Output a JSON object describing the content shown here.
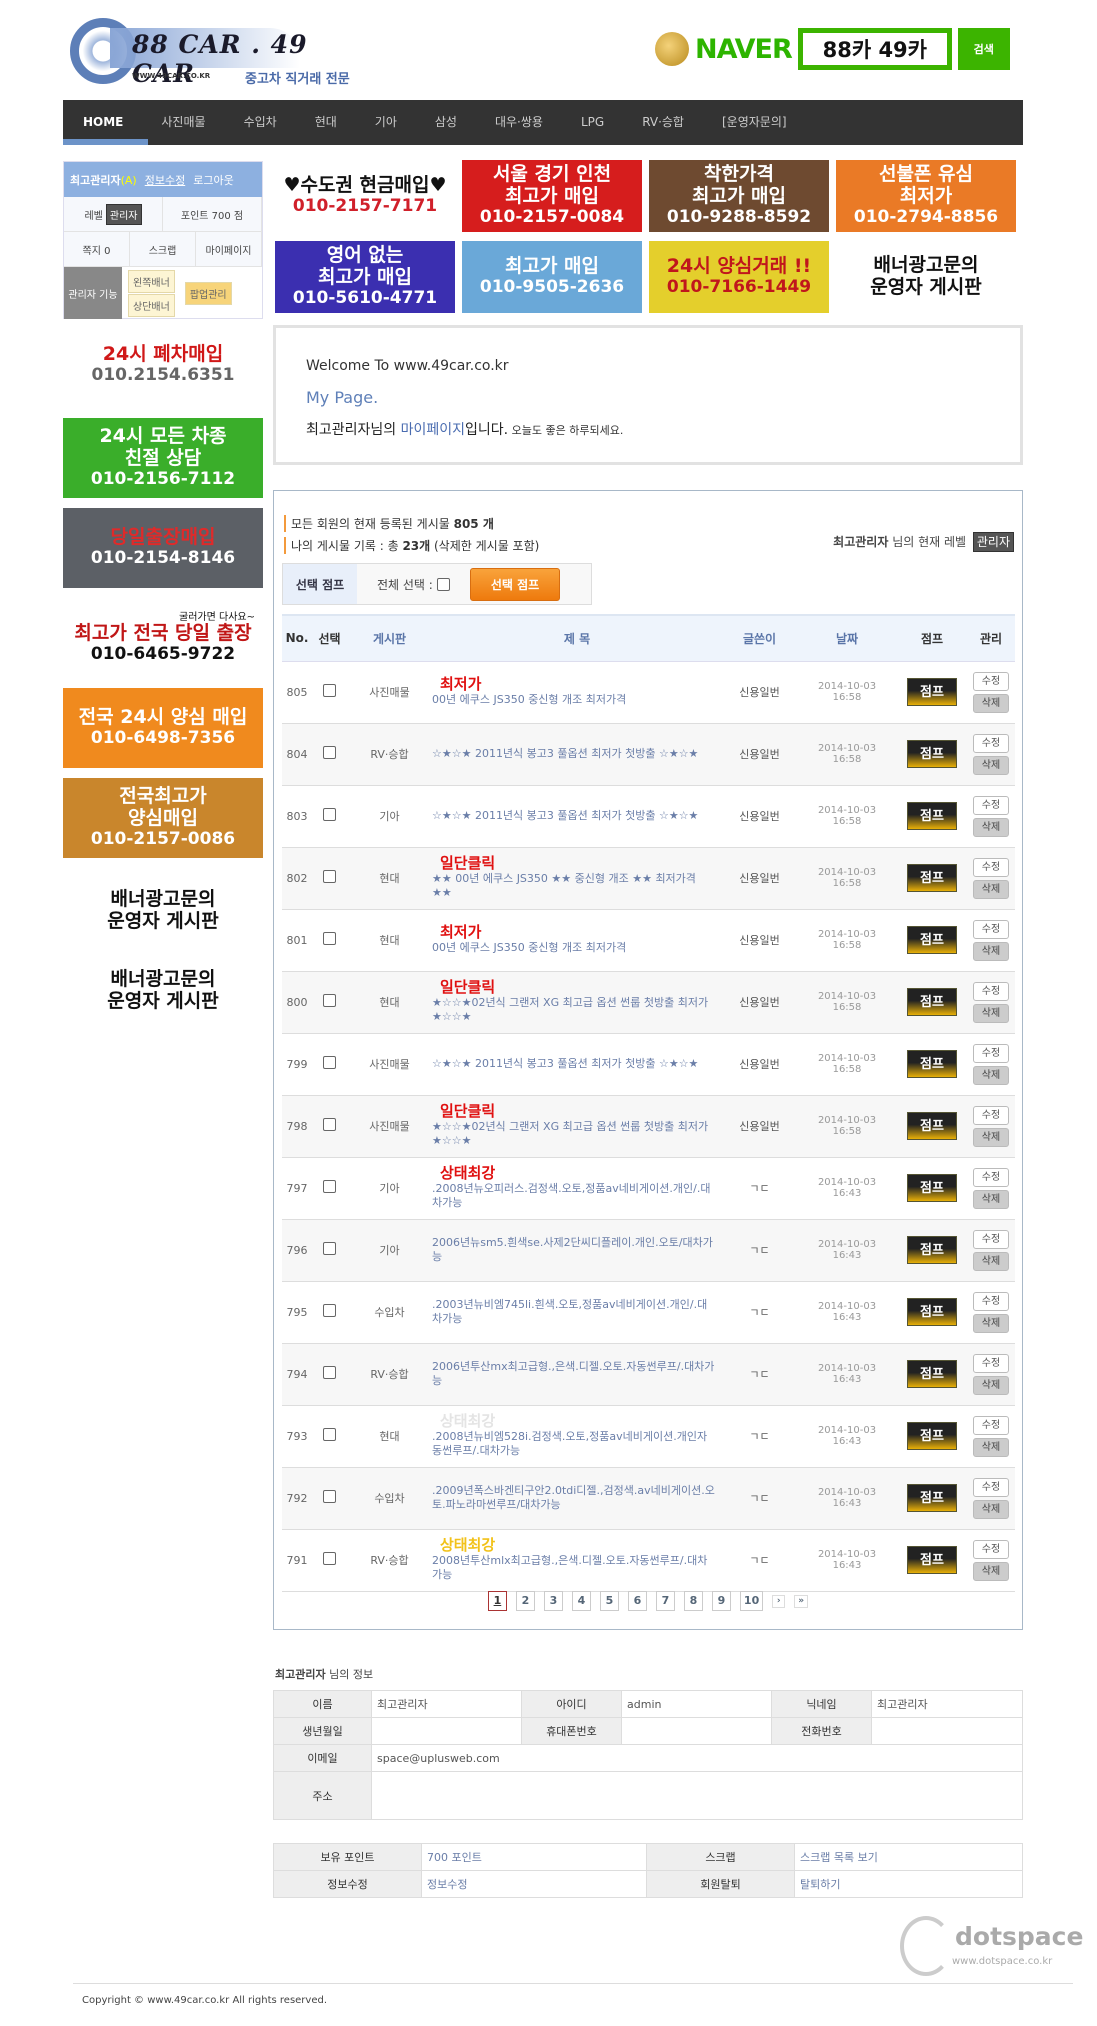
{
  "header": {
    "logo_title": "88 CAR . 49 CAR",
    "logo_url": "WWW.49CAR.CO.KR",
    "logo_sub": "중고차 직거래 전문",
    "naver_word": "NAVER",
    "naver_query": "88카 49카",
    "naver_search": "검색"
  },
  "nav": [
    "HOME",
    "사진매물",
    "수입차",
    "현대",
    "기아",
    "삼성",
    "대우·쌍용",
    "LPG",
    "RV·승합",
    "[운영자문의]"
  ],
  "login": {
    "user": "최고관리자",
    "grade": "(A)",
    "edit": "정보수정",
    "logout": "로그아웃",
    "level_label": "레벨",
    "level": "관리자",
    "points": "포인트 700 점",
    "memo": "쪽지 0",
    "scrap": "스크랩",
    "mypage": "마이페이지",
    "admin_label": "관리자 기능",
    "left_banner": "왼쪽배너",
    "top_banner": "상단배너",
    "popup": "팝업관리"
  },
  "top_banners": [
    {
      "t": "♥수도권 현금매입♥",
      "p": "010-2157-7171",
      "bg": "#ffffff",
      "fg": "#111",
      "pc": "#d0202a"
    },
    {
      "t": "서울 경기 인천\n최고가 매입",
      "p": "010-2157-0084",
      "bg": "#d61d1d",
      "fg": "#fff",
      "pc": "#fff"
    },
    {
      "t": "착한가격\n최고가 매입",
      "p": "010-9288-8592",
      "bg": "#6e4a30",
      "fg": "#fff",
      "pc": "#fff"
    },
    {
      "t": "선불폰 유심\n최저가",
      "p": "010-2794-8856",
      "bg": "#ea7a26",
      "fg": "#fff",
      "pc": "#fff"
    },
    {
      "t": "영어 없는\n최고가 매입",
      "p": "010-5610-4771",
      "bg": "#3b2fb0",
      "fg": "#fff",
      "pc": "#fff"
    },
    {
      "t": "최고가 매입",
      "p": "010-9505-2636",
      "bg": "#6aa8d8",
      "fg": "#fff",
      "pc": "#fff"
    },
    {
      "t": "24시 양심거래 !!",
      "p": "010-7166-1449",
      "bg": "#e4cf2c",
      "fg": "#c0161c",
      "pc": "#c0161c"
    },
    {
      "t": "배너광고문의\n운영자 게시판",
      "p": "",
      "bg": "#ffffff",
      "fg": "#111",
      "pc": "#111"
    }
  ],
  "left_banners": [
    {
      "t": "24시 폐차매입",
      "p": "010.2154.6351",
      "bg": "#ffffff",
      "fg": "#d01818",
      "pc": "#666"
    },
    {
      "t": "24시 모든 차종\n친절 상담",
      "p": "010-2156-7112",
      "bg": "#3aae2a",
      "fg": "#fff",
      "pc": "#fff"
    },
    {
      "t": "당일출장매입",
      "p": "010-2154-8146",
      "bg": "#5c6066",
      "fg": "#e02a2a",
      "pc": "#fff"
    },
    {
      "t": "최고가 전국 당일 출장",
      "sub": "굴러가면 다사요~",
      "p": "010-6465-9722",
      "bg": "#ffffff",
      "fg": "#c01616",
      "pc": "#111"
    },
    {
      "t": "전국 24시 양심 매입",
      "p": "010-6498-7356",
      "bg": "#f08a1e",
      "fg": "#fff",
      "pc": "#fff"
    },
    {
      "t": "전국최고가\n양심매입",
      "p": "010-2157-0086",
      "bg": "#c9862c",
      "fg": "#fff",
      "pc": "#fff"
    },
    {
      "t": "배너광고문의\n운영자 게시판",
      "p": "",
      "bg": "#ffffff",
      "fg": "#111",
      "pc": "#111"
    },
    {
      "t": "배너광고문의\n운영자 게시판",
      "p": "",
      "bg": "#ffffff",
      "fg": "#111",
      "pc": "#111"
    }
  ],
  "welcome": {
    "line1": "Welcome To www.49car.co.kr",
    "line2": "My Page.",
    "name": "최고관리자님의 ",
    "hl": "마이페이지",
    "end": "입니다.",
    "greet": " 오늘도 좋은 하루되세요."
  },
  "board": {
    "stat1_pre": "모든 회원의 현재 등록된 게시물 ",
    "stat1_count": "805 개",
    "stat2_pre": "나의 게시물 기록 : 총 ",
    "stat2_count": "23개",
    "stat2_post": " (삭제한 게시물 포함)",
    "level_user": "최고관리자",
    "level_text": " 님의 현재 레벨 ",
    "level_badge": "관리자",
    "jump_label": "선택 점프",
    "select_all": "전체 선택 :",
    "jump_button": "선택 점프",
    "columns": [
      "No.",
      "선택",
      "게시판",
      "제  목",
      "글쓴이",
      "날짜",
      "점프",
      "관리"
    ],
    "jump": "점프",
    "edit": "수정",
    "delete": "삭제",
    "rows": [
      {
        "no": "805",
        "board": "사진매물",
        "badge": "최저가",
        "badge_color": "#e01010",
        "title": "00년 에쿠스 JS350 중신형 개조 최저가격",
        "writer": "신용일번",
        "date": "2014-10-03",
        "time": "16:58"
      },
      {
        "no": "804",
        "board": "RV·승합",
        "badge": "",
        "badge_color": "",
        "title": "☆★☆★ 2011년식 봉고3 풀옵션 최저가 첫방출 ☆★☆★",
        "writer": "신용일번",
        "date": "2014-10-03",
        "time": "16:58"
      },
      {
        "no": "803",
        "board": "기아",
        "badge": "",
        "badge_color": "",
        "title": "☆★☆★ 2011년식 봉고3 풀옵션 최저가 첫방출 ☆★☆★",
        "writer": "신용일번",
        "date": "2014-10-03",
        "time": "16:58"
      },
      {
        "no": "802",
        "board": "현대",
        "badge": "일단클릭",
        "badge_color": "#e01010",
        "title": "★★ 00년 에쿠스 JS350 ★★ 중신형 개조 ★★ 최저가격 ★★",
        "writer": "신용일번",
        "date": "2014-10-03",
        "time": "16:58"
      },
      {
        "no": "801",
        "board": "현대",
        "badge": "최저가",
        "badge_color": "#e01010",
        "title": "00년 에쿠스 JS350 중신형 개조 최저가격",
        "writer": "신용일번",
        "date": "2014-10-03",
        "time": "16:58"
      },
      {
        "no": "800",
        "board": "현대",
        "badge": "일단클릭",
        "badge_color": "#e01010",
        "title": "★☆☆★02년식 그랜저 XG 최고급 옵션 썬룹 첫방출 최저가 ★☆☆★",
        "writer": "신용일번",
        "date": "2014-10-03",
        "time": "16:58"
      },
      {
        "no": "799",
        "board": "사진매물",
        "badge": "",
        "badge_color": "",
        "title": "☆★☆★ 2011년식 봉고3 풀옵션 최저가 첫방출 ☆★☆★",
        "writer": "신용일번",
        "date": "2014-10-03",
        "time": "16:58"
      },
      {
        "no": "798",
        "board": "사진매물",
        "badge": "일단클릭",
        "badge_color": "#e01010",
        "title": "★☆☆★02년식 그랜저 XG 최고급 옵션 썬룹 첫방출 최저가 ★☆☆★",
        "writer": "신용일번",
        "date": "2014-10-03",
        "time": "16:58"
      },
      {
        "no": "797",
        "board": "기아",
        "badge": "상태최강",
        "badge_color": "#e01010",
        "title": ".2008년뉴오피러스.검정색.오토,정품av네비게이션.개인/.대차가능",
        "writer": "ㄱㄷ",
        "date": "2014-10-03",
        "time": "16:43"
      },
      {
        "no": "796",
        "board": "기아",
        "badge": "",
        "badge_color": "",
        "title": "2006년뉴sm5.흰색se.사제2단씨디플레이.개인.오토/대차가능",
        "writer": "ㄱㄷ",
        "date": "2014-10-03",
        "time": "16:43"
      },
      {
        "no": "795",
        "board": "수입차",
        "badge": "",
        "badge_color": "",
        "title": ".2003년뉴비엠745li.흰색.오토,정품av네비게이션.개인/.대차가능",
        "writer": "ㄱㄷ",
        "date": "2014-10-03",
        "time": "16:43"
      },
      {
        "no": "794",
        "board": "RV·승합",
        "badge": "",
        "badge_color": "",
        "title": "2006년투산mx최고급형.,은색.디젤.오토.자동썬루프/.대차가능",
        "writer": "ㄱㄷ",
        "date": "2014-10-03",
        "time": "16:43"
      },
      {
        "no": "793",
        "board": "현대",
        "badge": "상태최강",
        "badge_color": "#e4e4e4",
        "title": ".2008년뉴비엠528i.검정색.오토,정품av네비게이션.개인자동썬루프/.대차가능",
        "writer": "ㄱㄷ",
        "date": "2014-10-03",
        "time": "16:43"
      },
      {
        "no": "792",
        "board": "수입차",
        "badge": "",
        "badge_color": "",
        "title": ".2009년폭스바겐티구안2.0tdi디젤.,검정색.av네비게이션.오토.파노라마썬루프/대차가능",
        "writer": "ㄱㄷ",
        "date": "2014-10-03",
        "time": "16:43"
      },
      {
        "no": "791",
        "board": "RV·승합",
        "badge": "상태최강",
        "badge_color": "#f2c21a",
        "title": "2008년투산mlx최고급형.,은색.디젤.오토.자동썬루프/.대차가능",
        "writer": "ㄱㄷ",
        "date": "2014-10-03",
        "time": "16:43"
      }
    ],
    "pages": [
      "1",
      "2",
      "3",
      "4",
      "5",
      "6",
      "7",
      "8",
      "9",
      "10"
    ],
    "current_page": "1",
    "next": "›",
    "last": "»"
  },
  "member": {
    "title_name": "최고관리자",
    "title_rest": " 님의 정보",
    "name_l": "이름",
    "name": "최고관리자",
    "id_l": "아이디",
    "id": "admin",
    "nick_l": "닉네임",
    "nick": "최고관리자",
    "birth_l": "생년월일",
    "mobile_l": "휴대폰번호",
    "phone_l": "전화번호",
    "email_l": "이메일",
    "email": "space@uplusweb.com",
    "addr_l": "주소",
    "points_l": "보유 포인트",
    "points": "700 포인트",
    "scrap_l": "스크랩",
    "scrap": "스크랩 목록 보기",
    "edit_l": "정보수정",
    "edit": "정보수정",
    "leave_l": "회원탈퇴",
    "leave": "탈퇴하기"
  },
  "footer": {
    "brand": "dotspace",
    "brand_url": "www.dotspace.co.kr",
    "copyright": "Copyright © www.49car.co.kr All rights reserved."
  }
}
